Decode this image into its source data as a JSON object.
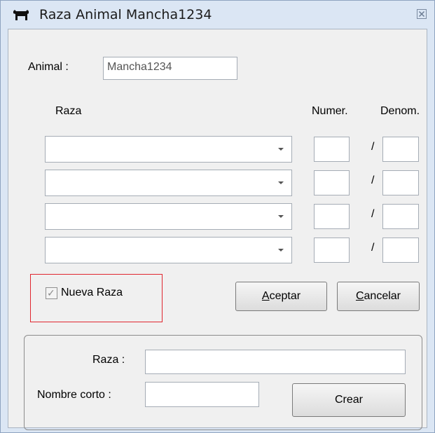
{
  "window": {
    "title": "Raza Animal Mancha1234",
    "icon": "cow-icon",
    "close_icon": "close-icon"
  },
  "animal": {
    "label": "Animal :",
    "value": "Mancha1234"
  },
  "breed_table": {
    "header_raza": "Raza",
    "header_numer": "Numer.",
    "header_denom": "Denom.",
    "separator": "/",
    "rows": [
      {
        "raza": "",
        "numer": "",
        "denom": ""
      },
      {
        "raza": "",
        "numer": "",
        "denom": ""
      },
      {
        "raza": "",
        "numer": "",
        "denom": ""
      },
      {
        "raza": "",
        "numer": "",
        "denom": ""
      }
    ]
  },
  "nueva_raza": {
    "label": "Nueva Raza",
    "checked": true
  },
  "actions": {
    "aceptar_accel": "A",
    "aceptar_rest": "ceptar",
    "cancelar_accel": "C",
    "cancelar_rest": "ancelar"
  },
  "new_breed": {
    "raza_label": "Raza :",
    "raza_value": "",
    "nombre_corto_label": "Nombre corto :",
    "nombre_corto_value": "",
    "crear_label": "Crear"
  },
  "colors": {
    "highlight": "#e0262e",
    "window_frame": "#dbe6f4",
    "client_bg": "#f0f0f0"
  }
}
